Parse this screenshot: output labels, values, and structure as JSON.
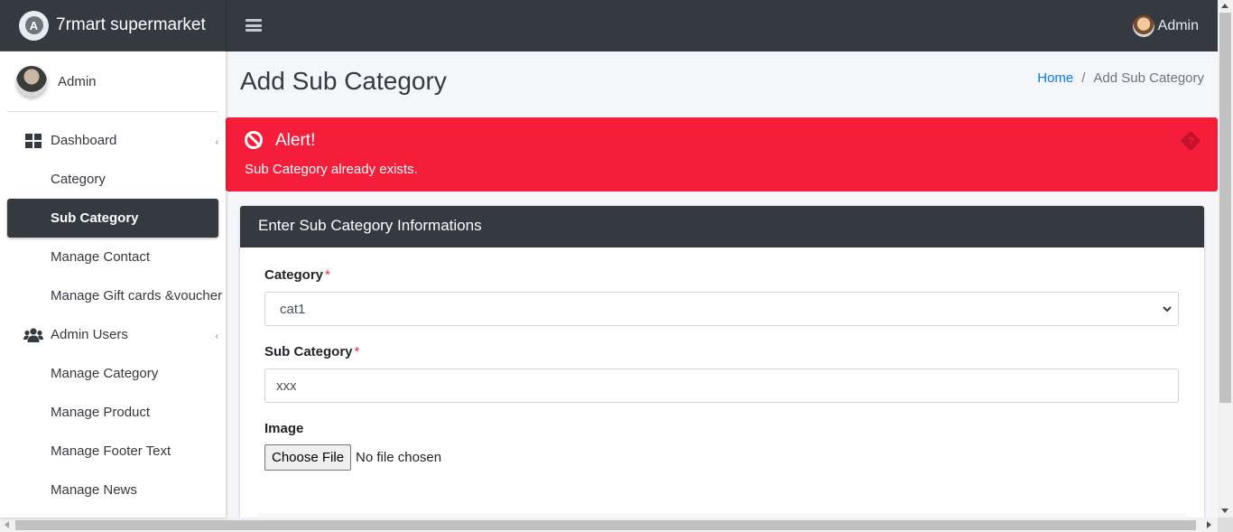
{
  "brand": {
    "name": "7rmart supermarket",
    "logo_icon": "brand-logo-icon"
  },
  "topbar": {
    "user_label": "Admin"
  },
  "sidebar": {
    "user_name": "Admin",
    "items": [
      {
        "label": "Dashboard",
        "icon": "dashboard-icon",
        "type": "section"
      },
      {
        "label": "Category",
        "type": "sub"
      },
      {
        "label": "Sub Category",
        "type": "sub",
        "active": true
      },
      {
        "label": "Manage Contact",
        "type": "sub"
      },
      {
        "label": "Manage Gift cards &voucher",
        "type": "sub"
      },
      {
        "label": "Admin Users",
        "icon": "users-icon",
        "type": "section"
      },
      {
        "label": "Manage Category",
        "type": "sub"
      },
      {
        "label": "Manage Product",
        "type": "sub"
      },
      {
        "label": "Manage Footer Text",
        "type": "sub"
      },
      {
        "label": "Manage News",
        "type": "sub"
      }
    ]
  },
  "page": {
    "title": "Add Sub Category",
    "breadcrumb": {
      "home": "Home",
      "separator": "/",
      "current": "Add Sub Category"
    }
  },
  "alert": {
    "title": "Alert!",
    "message": "Sub Category already exists.",
    "color": "#f41d3a"
  },
  "form": {
    "header": "Enter Sub Category Informations",
    "category": {
      "label": "Category",
      "required_mark": "*",
      "selected": "cat1"
    },
    "sub_category": {
      "label": "Sub Category",
      "required_mark": "*",
      "value": "xxx"
    },
    "image": {
      "label": "Image",
      "button": "Choose File",
      "status": "No file chosen"
    }
  },
  "colors": {
    "dark": "#343a40",
    "link": "#007bff",
    "danger": "#f41d3a"
  }
}
